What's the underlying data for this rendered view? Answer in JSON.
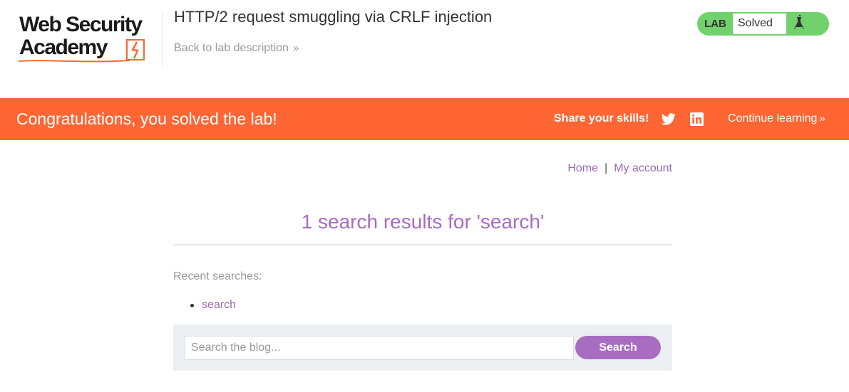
{
  "header": {
    "logo": {
      "line1": "Web Security",
      "line2": "Academy"
    },
    "lab_title": "HTTP/2 request smuggling via CRLF injection",
    "back_link": "Back to lab description",
    "status": {
      "tag": "LAB",
      "value": "Solved"
    }
  },
  "banner": {
    "message": "Congratulations, you solved the lab!",
    "share": "Share your skills!",
    "continue": "Continue learning"
  },
  "nav": {
    "home": "Home",
    "separator": "|",
    "account": "My account"
  },
  "main": {
    "results_title": "1 search results for 'search'",
    "recent_label": "Recent searches:",
    "recent_searches": [
      "search"
    ],
    "search": {
      "placeholder": "Search the blog...",
      "button": "Search"
    }
  },
  "colors": {
    "accent_orange": "#ff6633",
    "lab_green": "#70d16d",
    "link_purple": "#9d68b4",
    "button_purple": "#a86cc1",
    "panel_gray": "#ebeff2"
  }
}
